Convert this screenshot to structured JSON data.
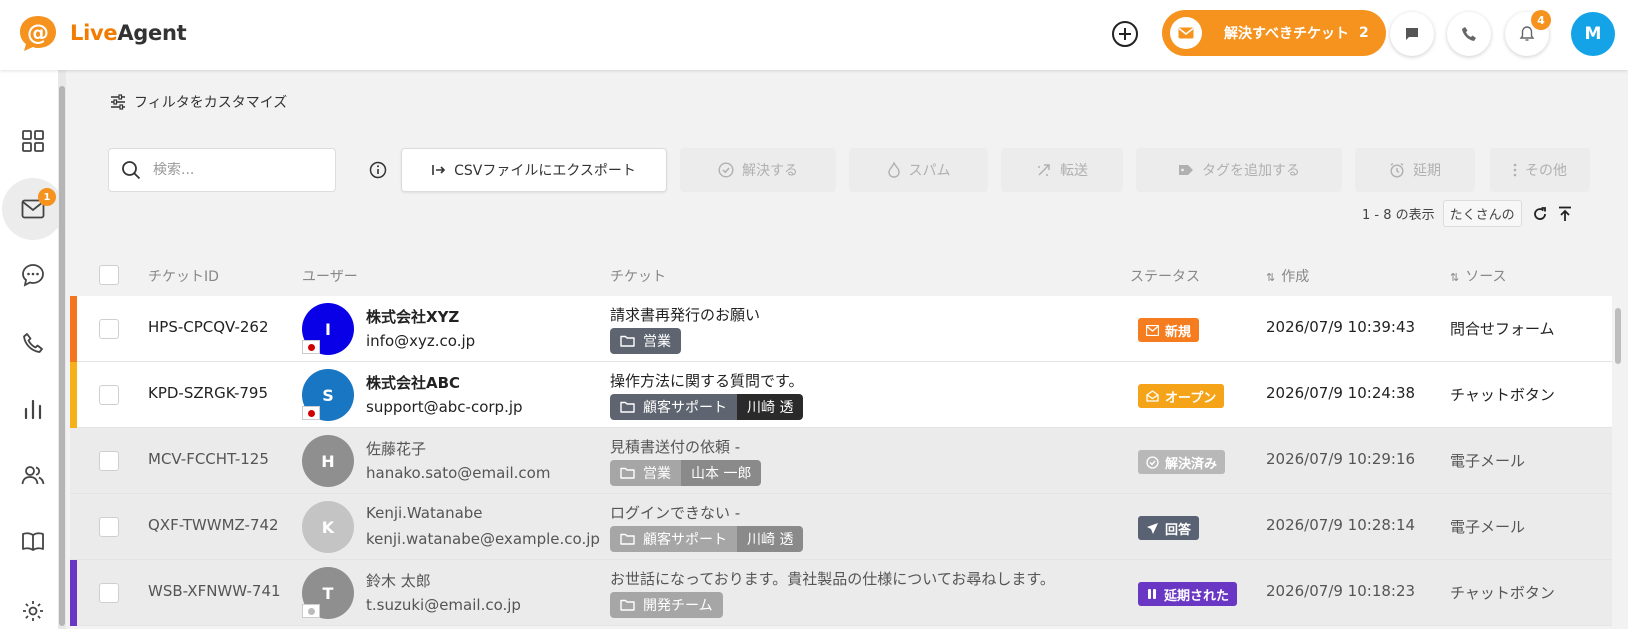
{
  "app": {
    "logo_text_a": "Live",
    "logo_text_b": "Agent",
    "resolve_label": "解決すべきチケット",
    "resolve_count": "2",
    "notif_count": "4",
    "user_initial": "M"
  },
  "sidebar": {
    "inbox_badge": "1",
    "items": [
      "dashboard",
      "tickets",
      "chats",
      "calls",
      "reports",
      "contacts",
      "knowledgebase",
      "settings"
    ]
  },
  "filter": {
    "label": "フィルタをカスタマイズ"
  },
  "toolbar": {
    "search_placeholder": "検索...",
    "export": "CSVファイルにエクスポート",
    "resolve": "解決する",
    "spam": "スパム",
    "transfer": "転送",
    "add_tag": "タグを追加する",
    "postpone": "延期",
    "other": "その他"
  },
  "pager": {
    "range": "1 - 8 の表示",
    "per_page": "たくさんの"
  },
  "columns": {
    "ticket_id": "チケットID",
    "user": "ユーザー",
    "ticket": "チケット",
    "status": "ステータス",
    "created": "作成",
    "source": "ソース"
  },
  "rows": [
    {
      "id": "HPS-CPCQV-262",
      "initial": "I",
      "avatar_color": "#0a00e8",
      "name": "株式会社XYZ",
      "email": "info@xyz.co.jp",
      "subject": "請求書再発行のお願い",
      "folder": "営業",
      "agent": "",
      "status": "新規",
      "status_color": "#f57c1f",
      "created": "2026/07/9 10:39:43",
      "source": "問合せフォーム",
      "stripe": "#f5741f",
      "read": false,
      "flag": "jp"
    },
    {
      "id": "KPD-SZRGK-795",
      "initial": "S",
      "avatar_color": "#1976c2",
      "name": "株式会社ABC",
      "email": "support@abc-corp.jp",
      "subject": "操作方法に関する質問です。",
      "folder": "顧客サポート",
      "agent": "川崎 透",
      "status": "オープン",
      "status_color": "#f5a41a",
      "created": "2026/07/9 10:24:38",
      "source": "チャットボタン",
      "stripe": "#f5b01a",
      "read": false,
      "flag": "jp"
    },
    {
      "id": "MCV-FCCHT-125",
      "initial": "H",
      "avatar_color": "#8f8f8f",
      "name": "佐藤花子",
      "email": "hanako.sato@email.com",
      "subject": "見積書送付の依頼 -",
      "folder": "営業",
      "agent": "山本 一郎",
      "status": "解決済み",
      "status_color": "#b8b8b8",
      "created": "2026/07/9 10:29:16",
      "source": "電子メール",
      "stripe": "",
      "read": true,
      "flag": ""
    },
    {
      "id": "QXF-TWWMZ-742",
      "initial": "K",
      "avatar_color": "#c4c4c4",
      "name": "Kenji.Watanabe",
      "email": "kenji.watanabe@example.co.jp",
      "subject": "ログインできない -",
      "folder": "顧客サポート",
      "agent": "川崎 透",
      "status": "回答",
      "status_color": "#596273",
      "created": "2026/07/9 10:28:14",
      "source": "電子メール",
      "stripe": "",
      "read": true,
      "flag": ""
    },
    {
      "id": "WSB-XFNWW-741",
      "initial": "T",
      "avatar_color": "#8f8f8f",
      "name": "鈴木 太郎",
      "email": "t.suzuki@email.co.jp",
      "subject": "お世話になっております。貴社製品の仕様についてお尋ねします。",
      "folder": "開発チーム",
      "agent": "",
      "status": "延期された",
      "status_color": "#6a36c4",
      "created": "2026/07/9 10:18:23",
      "source": "チャットボタン",
      "stripe": "#6a36c4",
      "read": true,
      "flag": "gray"
    }
  ]
}
